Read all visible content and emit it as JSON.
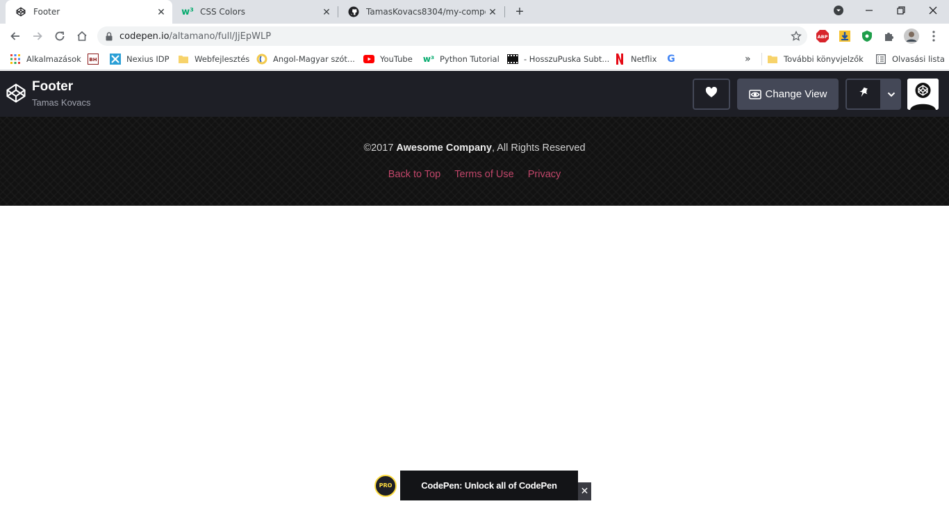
{
  "browser": {
    "tabs": [
      {
        "title": "Footer",
        "icon": "codepen-icon",
        "active": true
      },
      {
        "title": "CSS Colors",
        "icon": "w3schools-icon",
        "active": false
      },
      {
        "title": "TamasKovacs8304/my-componen",
        "icon": "github-icon",
        "active": false
      }
    ],
    "url_host": "codepen.io",
    "url_path": "/altamano/full/JjEpWLP",
    "extensions": [
      "adblock-icon",
      "download-icon",
      "shield-icon",
      "puzzle-icon",
      "profile-avatar-icon",
      "menu-dots-icon"
    ],
    "bookmarks": [
      {
        "label": "Alkalmazások",
        "icon": "apps-grid-icon"
      },
      {
        "label": "",
        "icon": "bh-icon"
      },
      {
        "label": "Nexius IDP",
        "icon": "nexius-icon"
      },
      {
        "label": "Webfejlesztés",
        "icon": "folder-icon"
      },
      {
        "label": "Angol-Magyar szót...",
        "icon": "dictionary-icon"
      },
      {
        "label": "YouTube",
        "icon": "youtube-icon"
      },
      {
        "label": "Python Tutorial",
        "icon": "w3schools-icon"
      },
      {
        "label": "- HosszuPuska Subt...",
        "icon": "film-icon"
      },
      {
        "label": "Netflix",
        "icon": "netflix-icon"
      },
      {
        "label": "",
        "icon": "google-icon"
      }
    ],
    "bookmarks_more": "»",
    "other_bookmarks": "További könyvjelzők",
    "reading_list": "Olvasási lista"
  },
  "codepen": {
    "title": "Footer",
    "author": "Tamas Kovacs",
    "change_view_label": "Change View"
  },
  "footer": {
    "copyright_prefix": "©2017 ",
    "company": "Awesome Company",
    "copyright_suffix": ", All Rights Reserved",
    "links": [
      "Back to Top",
      "Terms of Use",
      "Privacy"
    ],
    "link_color": "#c2466a"
  },
  "pro_banner": {
    "badge": "PRO",
    "text": "CodePen: Unlock all of CodePen",
    "close": "✕"
  }
}
